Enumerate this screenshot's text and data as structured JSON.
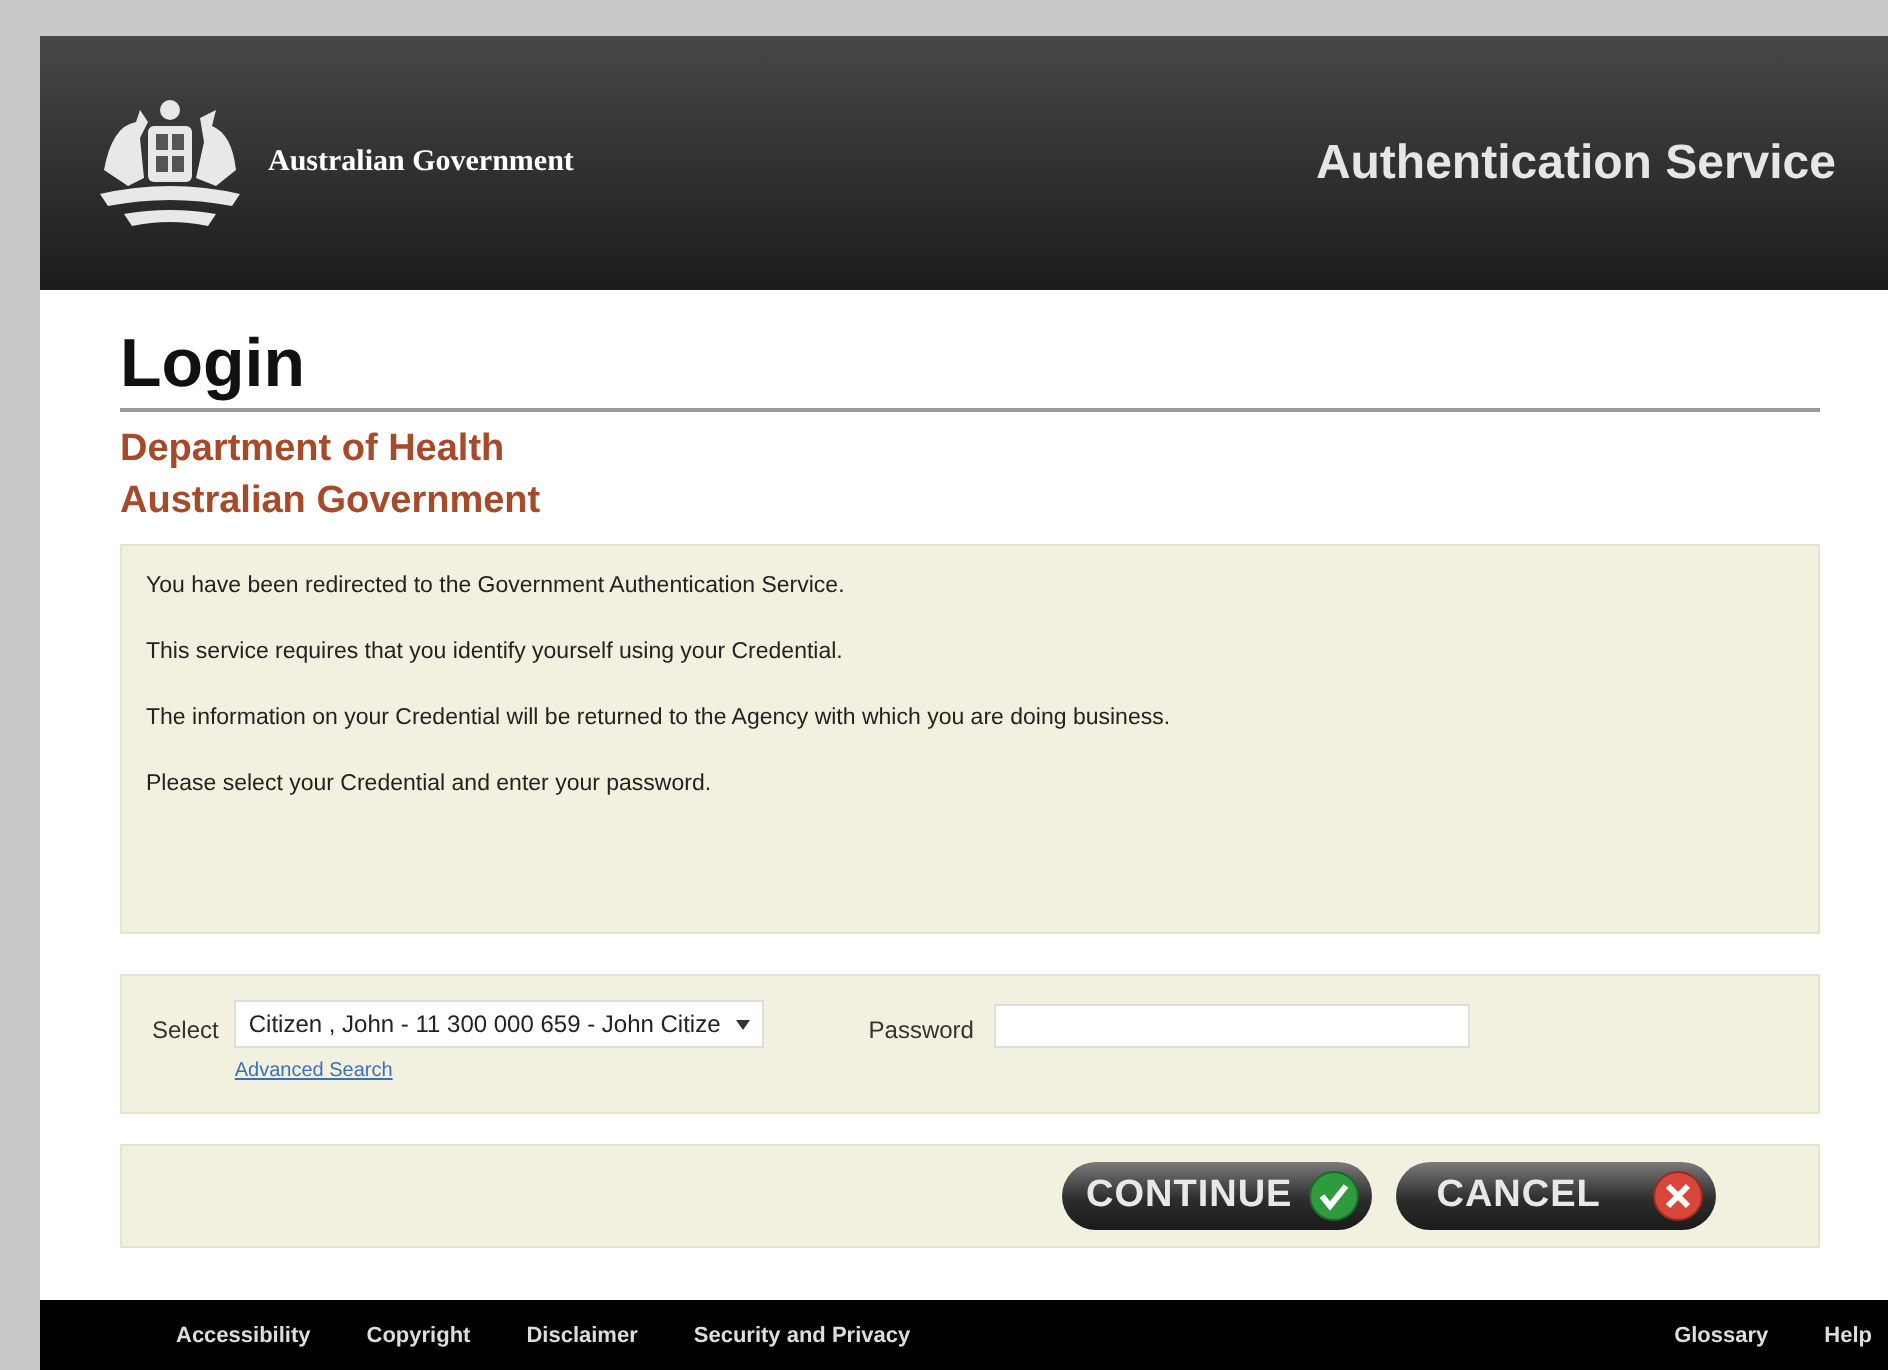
{
  "header": {
    "logo_text": "Australian Government",
    "service_title": "Authentication Service"
  },
  "page_title": "Login",
  "agency": [
    "Department of Health",
    "Australian Government"
  ],
  "messages": [
    "You have been redirected to the Government Authentication Service.",
    "This service requires that you identify yourself using your Credential.",
    "The information on your Credential will be returned to the Agency with which you are doing business.",
    "Please select your Credential and enter your password."
  ],
  "credential": {
    "label": "Select",
    "value": "Citizen , John - 11 300 000 659 - John Citize",
    "link": "Advanced Search"
  },
  "password": {
    "label": "Password"
  },
  "buttons": [
    {
      "label": "CONTINUE",
      "kind": "ok"
    },
    {
      "label": "CANCEL",
      "kind": "cancel"
    }
  ],
  "footer": {
    "left": [
      "Accessibility",
      "Copyright",
      "Disclaimer",
      "Security and Privacy"
    ],
    "right": [
      "Glossary",
      "Help"
    ]
  }
}
